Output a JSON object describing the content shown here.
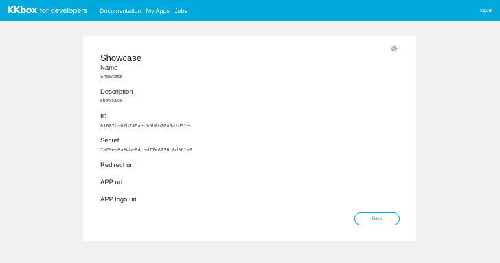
{
  "header": {
    "logo_mark": "KKbox",
    "logo_sub": "for developers",
    "nav": [
      {
        "label": "Documentation"
      },
      {
        "label": "My Apps"
      },
      {
        "label": "Jobs"
      }
    ],
    "logout_label": "logout",
    "background_color": "#00a9dc"
  },
  "app": {
    "title": "Showcase",
    "settings_icon": "gear-icon",
    "fields": {
      "name": {
        "label": "Name",
        "value": "Showcase"
      },
      "description": {
        "label": "Description",
        "value": "showcase"
      },
      "id": {
        "label": "ID",
        "value": "01687ba62b749aebb5b0b2048afd31ec"
      },
      "secret": {
        "label": "Secret",
        "value": "7a29ee8a34be0dced77e8736c8d361a9"
      },
      "redirect_uri": {
        "label": "Redirect uri",
        "value": ""
      },
      "app_uri": {
        "label": "APP uri",
        "value": ""
      },
      "app_logo_uri": {
        "label": "APP logo uri",
        "value": ""
      }
    },
    "back_label": "Back",
    "accent_color": "#00a9dc"
  }
}
